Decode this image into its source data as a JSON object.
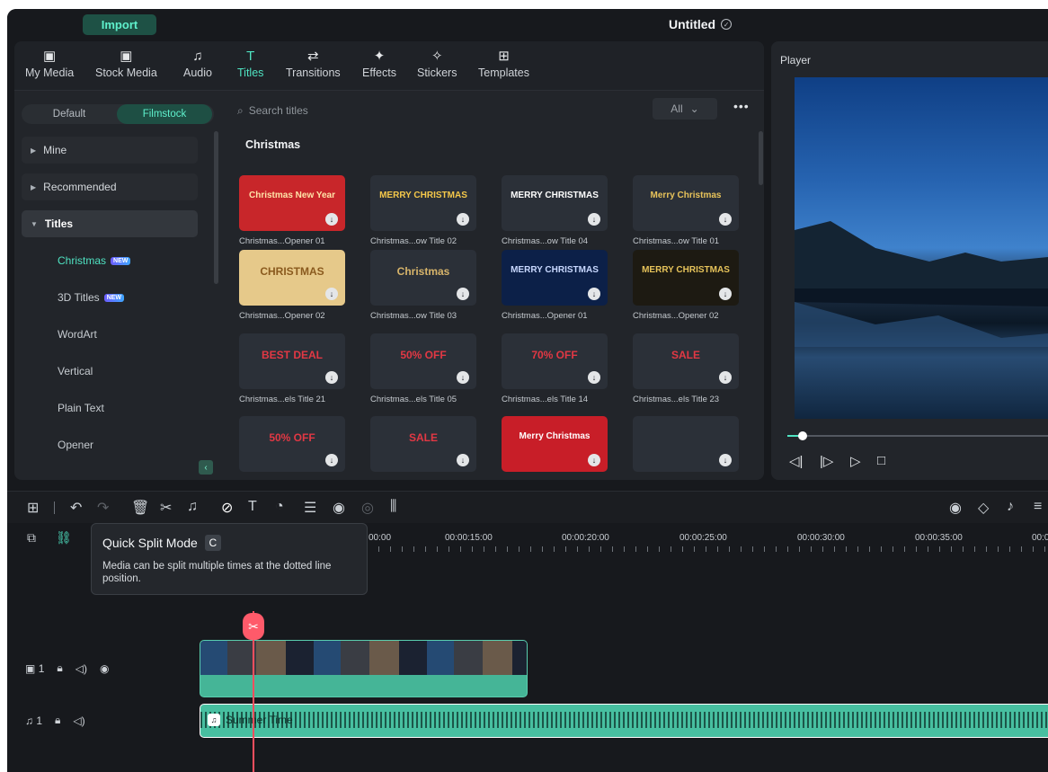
{
  "topbar": {
    "import_label": "Import",
    "doc_title": "Untitled"
  },
  "tabs": [
    {
      "label": "My Media",
      "icon": "▣"
    },
    {
      "label": "Stock Media",
      "icon": "▣"
    },
    {
      "label": "Audio",
      "icon": "♫"
    },
    {
      "label": "Titles",
      "icon": "T"
    },
    {
      "label": "Transitions",
      "icon": "⇄"
    },
    {
      "label": "Effects",
      "icon": "✦"
    },
    {
      "label": "Stickers",
      "icon": "✧"
    },
    {
      "label": "Templates",
      "icon": "⊞"
    }
  ],
  "sidebar": {
    "default_label": "Default",
    "filmstock_label": "Filmstock",
    "categories": [
      "Mine",
      "Recommended",
      "Titles"
    ],
    "subitems": [
      "Christmas",
      "3D Titles",
      "WordArt",
      "Vertical",
      "Plain Text",
      "Opener"
    ],
    "new_badge": "NEW"
  },
  "search": {
    "placeholder": "Search titles",
    "filter": "All"
  },
  "section_title": "Christmas",
  "cards": [
    {
      "caption": "Christmas...Opener 01",
      "text": "Christmas New Year",
      "bg": "#c8262a",
      "fg": "#ffe4a8"
    },
    {
      "caption": "Christmas...ow Title 02",
      "text": "MERRY CHRISTMAS",
      "bg": "#2b3038",
      "fg": "#f5c84a"
    },
    {
      "caption": "Christmas...ow Title 04",
      "text": "MERRY CHRISTMAS",
      "bg": "#2b3038",
      "fg": "#ffffff"
    },
    {
      "caption": "Christmas...ow Title 01",
      "text": "Merry Christmas",
      "bg": "#2b3038",
      "fg": "#e8c35a"
    },
    {
      "caption": "Christmas...Opener 02",
      "text": "CHRISTMAS",
      "bg": "#e6c98a",
      "fg": "#8a5a1e"
    },
    {
      "caption": "Christmas...ow Title 03",
      "text": "Christmas",
      "bg": "#2b3038",
      "fg": "#d7b46a"
    },
    {
      "caption": "Christmas...Opener 01",
      "text": "MERRY CHRISTMAS",
      "bg": "#0c2048",
      "fg": "#c8d8ff"
    },
    {
      "caption": "Christmas...Opener 02",
      "text": "MERRY CHRISTMAS",
      "bg": "#1d1a12",
      "fg": "#e6c35a"
    },
    {
      "caption": "Christmas...els Title 21",
      "text": "BEST DEAL",
      "bg": "#2b3038",
      "fg": "#e23844"
    },
    {
      "caption": "Christmas...els Title 05",
      "text": "50% OFF",
      "bg": "#2b3038",
      "fg": "#e23844"
    },
    {
      "caption": "Christmas...els Title 14",
      "text": "70% OFF",
      "bg": "#2b3038",
      "fg": "#e23844"
    },
    {
      "caption": "Christmas...els Title 23",
      "text": "SALE",
      "bg": "#2b3038",
      "fg": "#e23844"
    },
    {
      "caption": "",
      "text": "50% OFF",
      "bg": "#2b3038",
      "fg": "#e23844"
    },
    {
      "caption": "",
      "text": "SALE",
      "bg": "#2b3038",
      "fg": "#e23844"
    },
    {
      "caption": "",
      "text": "Merry Christmas",
      "bg": "#c81e28",
      "fg": "#ffffff"
    },
    {
      "caption": "",
      "text": "",
      "bg": "#2b3038",
      "fg": "#e23844"
    }
  ],
  "player": {
    "title": "Player"
  },
  "timeline": {
    "ruler": [
      "00:00",
      "00:00:15:00",
      "00:00:20:00",
      "00:00:25:00",
      "00:00:30:00",
      "00:00:35:00",
      "00:0"
    ],
    "video_track_label": "1",
    "audio_track_label": "1",
    "audio_clip_title": "Summer Time"
  },
  "tooltip": {
    "title": "Quick Split Mode",
    "key": "C",
    "body": "Media can be split multiple times at the dotted line position."
  },
  "colors": {
    "accent": "#4fe3c2",
    "playhead": "#ff4f5e",
    "clip": "#47bfa0"
  }
}
